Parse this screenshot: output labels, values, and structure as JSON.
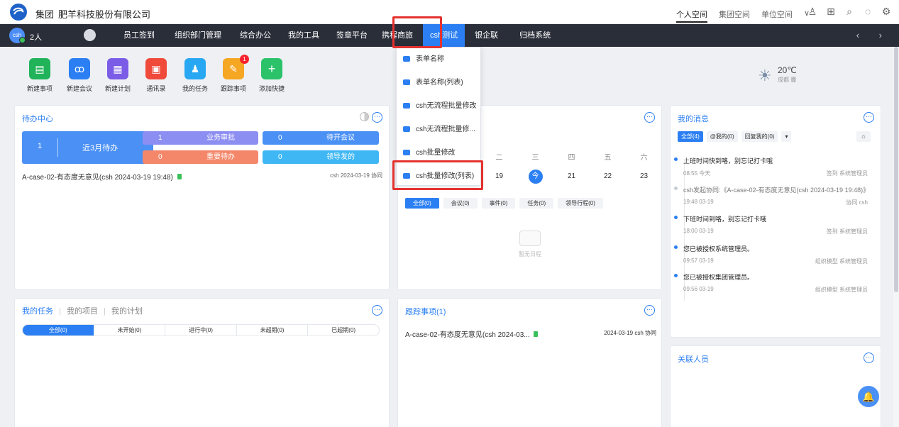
{
  "topbar": {
    "group": "集团",
    "company": "肥羊科技股份有限公司",
    "spaces": [
      "个人空间",
      "集团空间",
      "单位空间"
    ],
    "icons": [
      "user-icon",
      "grid-icon",
      "search-icon",
      "chat-icon",
      "settings-icon"
    ]
  },
  "navbar": {
    "avatar": "csh",
    "people": "2人",
    "items": [
      "员工签到",
      "组织部门管理",
      "综合办公",
      "我的工具",
      "签章平台",
      "携程商旅",
      "csh测试",
      "银企联",
      "归档系统"
    ]
  },
  "quick": {
    "items": [
      {
        "label": "新建事项",
        "color": "#21b35a"
      },
      {
        "label": "新建会议",
        "color": "#2b7ff2"
      },
      {
        "label": "新建计划",
        "color": "#7b5ce6"
      },
      {
        "label": "通讯录",
        "color": "#f04a3b"
      },
      {
        "label": "我的任务",
        "color": "#28a7f2"
      },
      {
        "label": "跟踪事项",
        "color": "#f5a623",
        "badge": "1"
      },
      {
        "label": "添加快捷",
        "color": "#2bc26a"
      }
    ]
  },
  "weather": {
    "temp": "20℃",
    "city": "成都 霾"
  },
  "todo": {
    "title": "待办中心",
    "main": {
      "count": "1",
      "label": "近3月待办"
    },
    "chips": [
      {
        "count": "1",
        "label": "业务审批",
        "color": "#8d8ef2"
      },
      {
        "count": "0",
        "label": "待开会议",
        "color": "#4a90f5"
      },
      {
        "count": "0",
        "label": "重要待办",
        "color": "#f4876a"
      },
      {
        "count": "0",
        "label": "领导发的",
        "color": "#3fb7f5"
      }
    ],
    "row": {
      "text": "A-case-02-有态度无意见(csh 2024-03-19 19:48)",
      "meta": "csh   2024-03-19   协同"
    }
  },
  "dropdown": {
    "items": [
      "表单名称",
      "表单名称(列表)",
      "csh无流程批量修改",
      "csh无流程批量修...",
      "csh批量修改",
      "csh批量修改(列表)"
    ]
  },
  "calendar": {
    "weekdays": [
      "二",
      "三",
      "四",
      "五",
      "六"
    ],
    "days": [
      "19",
      "今",
      "21",
      "22",
      "23"
    ],
    "tabs": [
      "全部(0)",
      "会议(0)",
      "事件(0)",
      "任务(0)",
      "领导行程(0)"
    ],
    "empty": "暂无日程"
  },
  "messages": {
    "title": "我的消息",
    "tabs": [
      "全部(4)",
      "@我的(0)",
      "回复我的(0)",
      "▾"
    ],
    "items": [
      {
        "text": "上班时间快到咯，别忘记打卡哦",
        "time": "08:55 今天",
        "src": "签到 系统管理员"
      },
      {
        "text": "csh发起协同:《A-case-02-有态度无意见(csh 2024-03-19 19:48)》",
        "time": "19:48 03-19",
        "src": "协同 csh"
      },
      {
        "text": "下班时间到咯，别忘记打卡哦",
        "time": "18:00 03-19",
        "src": "签到 系统管理员"
      },
      {
        "text": "您已被授权系统管理员。",
        "time": "09:57 03-19",
        "src": "组织模型 系统管理员"
      },
      {
        "text": "您已被授权集团管理员。",
        "time": "09:56 03-19",
        "src": "组织模型 系统管理员"
      }
    ]
  },
  "tasks": {
    "tabs": [
      "我的任务",
      "我的项目",
      "我的计划"
    ],
    "seg": [
      "全部(0)",
      "未开始(0)",
      "进行中(0)",
      "未超期(0)",
      "已超期(0)"
    ]
  },
  "tracking": {
    "title": "跟踪事项(1)",
    "row": {
      "text": "A-case-02-有态度无意见(csh 2024-03...",
      "meta": "2024-03-19   csh   协同"
    }
  },
  "related": {
    "title": "关联人员"
  }
}
